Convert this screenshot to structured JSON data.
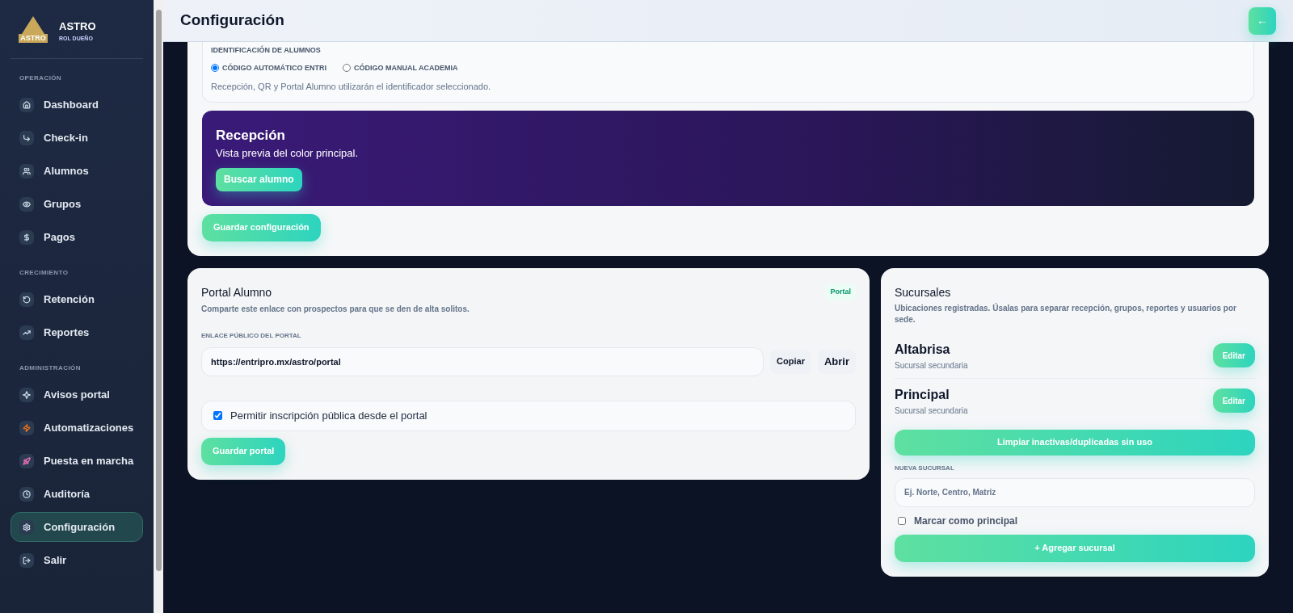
{
  "brand": {
    "name": "ASTRO",
    "role": "ROL DUEÑO",
    "logo_text": "ASTRO"
  },
  "sidebar": {
    "sections": [
      {
        "title": "OPERACIÓN",
        "items": [
          {
            "label": "Dashboard",
            "selected": false
          },
          {
            "label": "Check-in",
            "selected": false
          },
          {
            "label": "Alumnos",
            "selected": false
          },
          {
            "label": "Grupos",
            "selected": false
          },
          {
            "label": "Pagos",
            "selected": false
          }
        ]
      },
      {
        "title": "CRECIMIENTO",
        "items": [
          {
            "label": "Retención",
            "selected": false
          },
          {
            "label": "Reportes",
            "selected": false
          }
        ]
      },
      {
        "title": "ADMINISTRACIÓN",
        "items": [
          {
            "label": "Avisos portal",
            "selected": false
          },
          {
            "label": "Automatizaciones",
            "selected": false
          },
          {
            "label": "Puesta en marcha",
            "selected": false
          },
          {
            "label": "Auditoría",
            "selected": false
          },
          {
            "label": "Configuración",
            "selected": true
          },
          {
            "label": "Salir",
            "selected": false
          }
        ]
      }
    ]
  },
  "header": {
    "title": "Configuración",
    "back_button": "←"
  },
  "identification": {
    "title": "IDENTIFICACIÓN DE ALUMNOS",
    "options": [
      {
        "label": "CÓDIGO AUTOMÁTICO ENTRI",
        "selected": true
      },
      {
        "label": "CÓDIGO MANUAL ACADEMIA",
        "selected": false
      }
    ],
    "note": "Recepción, QR y Portal Alumno utilizarán el identificador seleccionado."
  },
  "preview": {
    "title": "Recepción",
    "subtitle": "Vista previa del color principal.",
    "button": "Buscar alumno"
  },
  "save_config_button": "Guardar configuración",
  "portal": {
    "title": "Portal Alumno",
    "badge": "Portal",
    "description": "Comparte este enlace con prospectos para que se den de alta solitos.",
    "link_label": "ENLACE PÚBLICO DEL PORTAL",
    "link_value": "https://entripro.mx/astro/portal",
    "copy_button": "Copiar",
    "open_button": "Abrir",
    "allow_signup": {
      "label": "Permitir inscripción pública desde el portal",
      "checked": true
    },
    "save_button": "Guardar portal"
  },
  "branches": {
    "title": "Sucursales",
    "description": "Ubicaciones registradas. Úsalas para separar recepción, grupos, reportes y usuarios por sede.",
    "items": [
      {
        "name": "Altabrisa",
        "type": "Sucursal secundaria",
        "edit_button": "Editar"
      },
      {
        "name": "Principal",
        "type": "Sucursal secundaria",
        "edit_button": "Editar"
      }
    ],
    "cleanup_button": "Limpiar inactivas/duplicadas sin uso",
    "new_label": "NUEVA SUCURSAL",
    "new_placeholder": "Ej. Norte, Centro, Matriz",
    "mark_principal": {
      "label": "Marcar como principal",
      "checked": false
    },
    "add_button": "+ Agregar sucursal"
  }
}
